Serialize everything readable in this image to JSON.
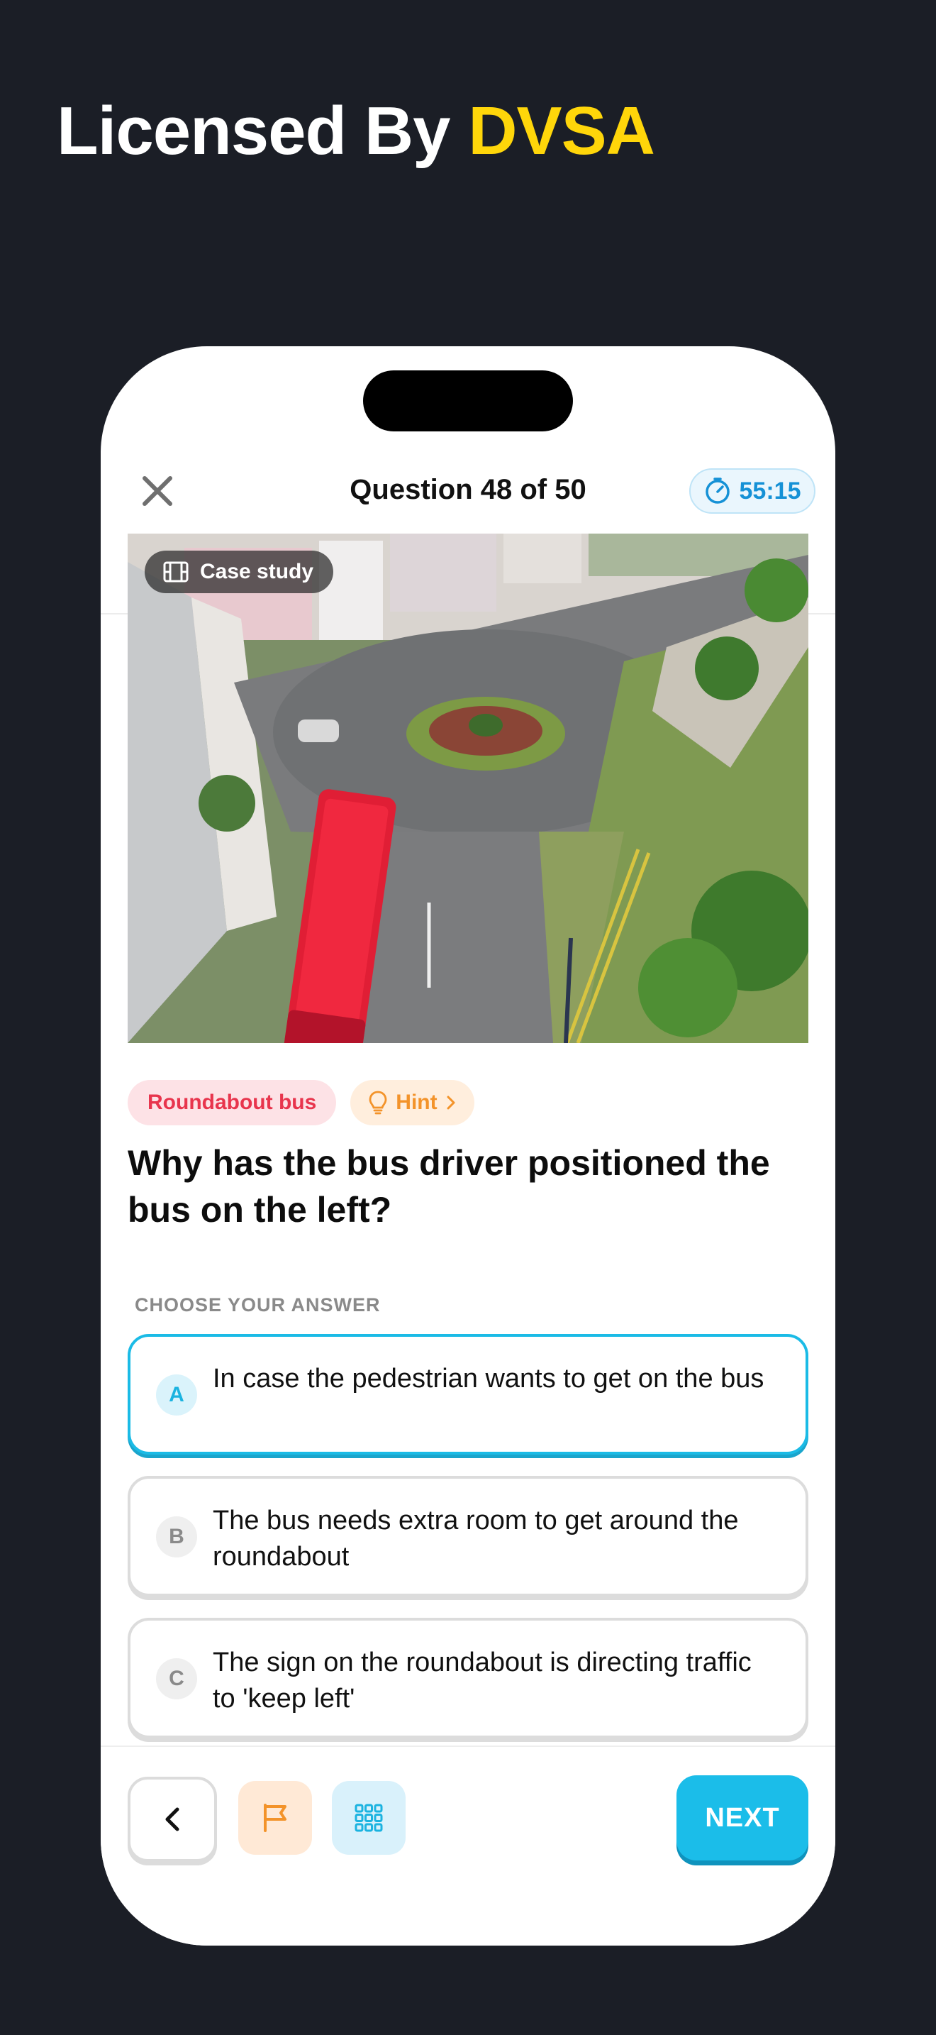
{
  "header": {
    "headline_prefix": "Licensed By",
    "headline_accent": "DVSA"
  },
  "topbar": {
    "close_icon": "close-icon",
    "title": "Question 48 of 50",
    "timer": "55:15",
    "timer_icon": "stopwatch-icon"
  },
  "media": {
    "badge_label": "Case study",
    "badge_icon": "film-icon",
    "image_description": "roundabout-scene"
  },
  "chips": {
    "topic": "Roundabout bus",
    "hint_label": "Hint",
    "hint_icon": "lightbulb-icon"
  },
  "question": {
    "text": "Why has the bus driver positioned the bus on the left?",
    "choose_label": "CHOOSE YOUR ANSWER"
  },
  "answers": [
    {
      "letter": "A",
      "text": "In case the pedestrian wants to get on the bus",
      "selected": true
    },
    {
      "letter": "B",
      "text": "The bus needs extra room to get around the roundabout",
      "selected": false
    },
    {
      "letter": "C",
      "text": "The sign on the roundabout is directing traffic to 'keep left'",
      "selected": false
    }
  ],
  "bottombar": {
    "back_icon": "chevron-left-icon",
    "flag_icon": "flag-icon",
    "grid_icon": "grid-icon",
    "next_label": "NEXT"
  },
  "colors": {
    "background": "#1b1e26",
    "accent_yellow": "#ffd60a",
    "primary_blue": "#1bbde9",
    "topic_red": "#e8354d",
    "hint_orange": "#f3932a"
  }
}
